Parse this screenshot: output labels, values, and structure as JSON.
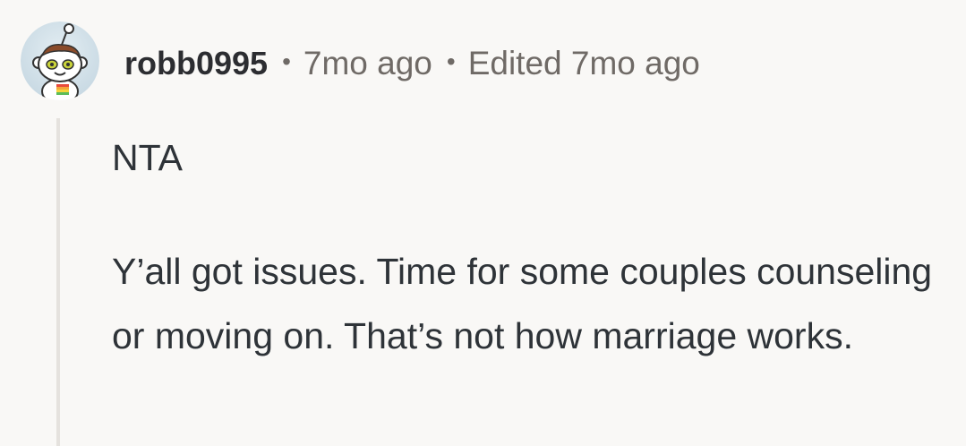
{
  "comment": {
    "avatar_icon": "snoo-avatar-icon",
    "username": "robb0995",
    "separator": "•",
    "age": "7mo ago",
    "edited": "Edited 7mo ago",
    "body": {
      "paragraph_1": "NTA",
      "paragraph_2": "Y’all got issues. Time for some couples counseling or moving on. That’s not how marriage works."
    }
  },
  "colors": {
    "background": "#f9f8f6",
    "username": "#2c2d31",
    "meta_text": "#6f6a66",
    "body_text": "#2e3338",
    "thread_line": "#e5e2de"
  }
}
